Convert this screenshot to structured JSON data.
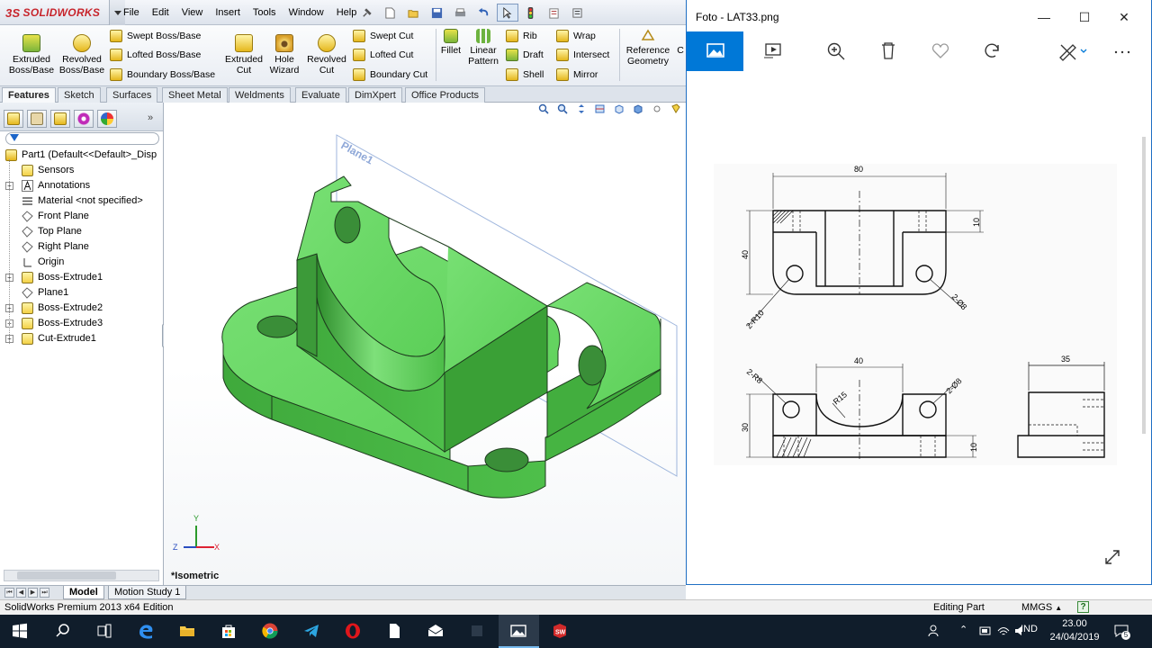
{
  "app": {
    "logo_prefix": "3S",
    "logo_text": "SOLIDWORKS",
    "menus": [
      "File",
      "Edit",
      "View",
      "Insert",
      "Tools",
      "Window",
      "Help"
    ]
  },
  "command_manager": {
    "extruded_boss": "Extruded Boss/Base",
    "revolved_boss": "Revolved Boss/Base",
    "swept_boss": "Swept Boss/Base",
    "lofted_boss": "Lofted Boss/Base",
    "boundary_boss": "Boundary Boss/Base",
    "extruded_cut": "Extruded Cut",
    "hole_wizard": "Hole Wizard",
    "revolved_cut": "Revolved Cut",
    "swept_cut": "Swept Cut",
    "lofted_cut": "Lofted Cut",
    "boundary_cut": "Boundary Cut",
    "fillet": "Fillet",
    "linear_pattern": "Linear Pattern",
    "rib": "Rib",
    "draft": "Draft",
    "shell": "Shell",
    "wrap": "Wrap",
    "intersect": "Intersect",
    "mirror": "Mirror",
    "reference_geometry": "Reference Geometry",
    "curves_partial": "C"
  },
  "tabs": [
    "Features",
    "Sketch",
    "Surfaces",
    "Sheet Metal",
    "Weldments",
    "Evaluate",
    "DimXpert",
    "Office Products"
  ],
  "tree": {
    "root": "Part1  (Default<<Default>_Disp",
    "items": [
      {
        "label": "Sensors",
        "expandable": false,
        "icon": "sensor-icon"
      },
      {
        "label": "Annotations",
        "expandable": true,
        "icon": "annotation-icon"
      },
      {
        "label": "Material <not specified>",
        "expandable": false,
        "icon": "material-icon"
      },
      {
        "label": "Front Plane",
        "expandable": false,
        "icon": "plane-icon"
      },
      {
        "label": "Top Plane",
        "expandable": false,
        "icon": "plane-icon"
      },
      {
        "label": "Right Plane",
        "expandable": false,
        "icon": "plane-icon"
      },
      {
        "label": "Origin",
        "expandable": false,
        "icon": "origin-icon"
      },
      {
        "label": "Boss-Extrude1",
        "expandable": true,
        "icon": "extrude-icon"
      },
      {
        "label": "Plane1",
        "expandable": false,
        "icon": "plane-icon"
      },
      {
        "label": "Boss-Extrude2",
        "expandable": true,
        "icon": "extrude-icon"
      },
      {
        "label": "Boss-Extrude3",
        "expandable": true,
        "icon": "extrude-icon"
      },
      {
        "label": "Cut-Extrude1",
        "expandable": true,
        "icon": "cut-icon"
      }
    ]
  },
  "graphics": {
    "plane_label": "Plane1",
    "view_name": "*Isometric",
    "triad": {
      "x": "X",
      "y": "Y",
      "z": "Z"
    },
    "model_color": "#5fcf5f"
  },
  "bottom_tabs": [
    "Model",
    "Motion Study 1"
  ],
  "status": {
    "edition": "SolidWorks Premium 2013 x64 Edition",
    "mode": "Editing Part",
    "units": "MMGS",
    "units_arrow": "▲",
    "help": "?"
  },
  "photos": {
    "title": "Foto - LAT33.png",
    "accent": "#0078d7",
    "drawing": {
      "dim_80": "80",
      "dim_10_top": "10",
      "dim_40_height": "40",
      "note_r10": "2-R10",
      "note_d8_top": "2-Ø8",
      "dim_40_width": "40",
      "note_r8": "2-R8",
      "note_r15": "R15",
      "note_d8_front": "2-Ø8",
      "dim_30": "30",
      "dim_10_front": "10",
      "dim_35": "35"
    }
  },
  "taskbar": {
    "language": "IND",
    "time": "23.00",
    "date": "24/04/2019",
    "notifications": "5"
  }
}
